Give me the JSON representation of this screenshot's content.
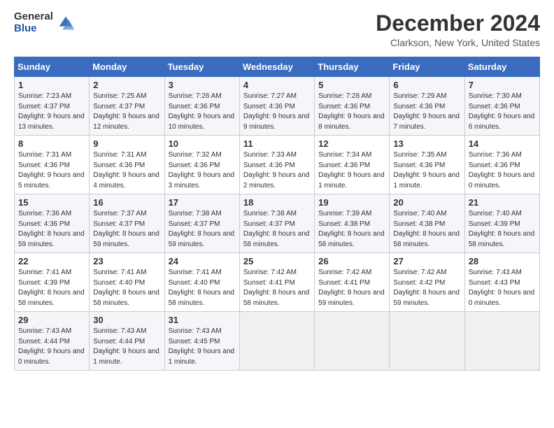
{
  "logo": {
    "general": "General",
    "blue": "Blue"
  },
  "title": "December 2024",
  "location": "Clarkson, New York, United States",
  "headers": [
    "Sunday",
    "Monday",
    "Tuesday",
    "Wednesday",
    "Thursday",
    "Friday",
    "Saturday"
  ],
  "weeks": [
    [
      {
        "day": "1",
        "sunrise": "7:23 AM",
        "sunset": "4:37 PM",
        "daylight": "9 hours and 13 minutes."
      },
      {
        "day": "2",
        "sunrise": "7:25 AM",
        "sunset": "4:37 PM",
        "daylight": "9 hours and 12 minutes."
      },
      {
        "day": "3",
        "sunrise": "7:26 AM",
        "sunset": "4:36 PM",
        "daylight": "9 hours and 10 minutes."
      },
      {
        "day": "4",
        "sunrise": "7:27 AM",
        "sunset": "4:36 PM",
        "daylight": "9 hours and 9 minutes."
      },
      {
        "day": "5",
        "sunrise": "7:28 AM",
        "sunset": "4:36 PM",
        "daylight": "9 hours and 8 minutes."
      },
      {
        "day": "6",
        "sunrise": "7:29 AM",
        "sunset": "4:36 PM",
        "daylight": "9 hours and 7 minutes."
      },
      {
        "day": "7",
        "sunrise": "7:30 AM",
        "sunset": "4:36 PM",
        "daylight": "9 hours and 6 minutes."
      }
    ],
    [
      {
        "day": "8",
        "sunrise": "7:31 AM",
        "sunset": "4:36 PM",
        "daylight": "9 hours and 5 minutes."
      },
      {
        "day": "9",
        "sunrise": "7:31 AM",
        "sunset": "4:36 PM",
        "daylight": "9 hours and 4 minutes."
      },
      {
        "day": "10",
        "sunrise": "7:32 AM",
        "sunset": "4:36 PM",
        "daylight": "9 hours and 3 minutes."
      },
      {
        "day": "11",
        "sunrise": "7:33 AM",
        "sunset": "4:36 PM",
        "daylight": "9 hours and 2 minutes."
      },
      {
        "day": "12",
        "sunrise": "7:34 AM",
        "sunset": "4:36 PM",
        "daylight": "9 hours and 1 minute."
      },
      {
        "day": "13",
        "sunrise": "7:35 AM",
        "sunset": "4:36 PM",
        "daylight": "9 hours and 1 minute."
      },
      {
        "day": "14",
        "sunrise": "7:36 AM",
        "sunset": "4:36 PM",
        "daylight": "9 hours and 0 minutes."
      }
    ],
    [
      {
        "day": "15",
        "sunrise": "7:36 AM",
        "sunset": "4:36 PM",
        "daylight": "8 hours and 59 minutes."
      },
      {
        "day": "16",
        "sunrise": "7:37 AM",
        "sunset": "4:37 PM",
        "daylight": "8 hours and 59 minutes."
      },
      {
        "day": "17",
        "sunrise": "7:38 AM",
        "sunset": "4:37 PM",
        "daylight": "8 hours and 59 minutes."
      },
      {
        "day": "18",
        "sunrise": "7:38 AM",
        "sunset": "4:37 PM",
        "daylight": "8 hours and 58 minutes."
      },
      {
        "day": "19",
        "sunrise": "7:39 AM",
        "sunset": "4:38 PM",
        "daylight": "8 hours and 58 minutes."
      },
      {
        "day": "20",
        "sunrise": "7:40 AM",
        "sunset": "4:38 PM",
        "daylight": "8 hours and 58 minutes."
      },
      {
        "day": "21",
        "sunrise": "7:40 AM",
        "sunset": "4:39 PM",
        "daylight": "8 hours and 58 minutes."
      }
    ],
    [
      {
        "day": "22",
        "sunrise": "7:41 AM",
        "sunset": "4:39 PM",
        "daylight": "8 hours and 58 minutes."
      },
      {
        "day": "23",
        "sunrise": "7:41 AM",
        "sunset": "4:40 PM",
        "daylight": "8 hours and 58 minutes."
      },
      {
        "day": "24",
        "sunrise": "7:41 AM",
        "sunset": "4:40 PM",
        "daylight": "8 hours and 58 minutes."
      },
      {
        "day": "25",
        "sunrise": "7:42 AM",
        "sunset": "4:41 PM",
        "daylight": "8 hours and 58 minutes."
      },
      {
        "day": "26",
        "sunrise": "7:42 AM",
        "sunset": "4:41 PM",
        "daylight": "8 hours and 59 minutes."
      },
      {
        "day": "27",
        "sunrise": "7:42 AM",
        "sunset": "4:42 PM",
        "daylight": "8 hours and 59 minutes."
      },
      {
        "day": "28",
        "sunrise": "7:43 AM",
        "sunset": "4:43 PM",
        "daylight": "9 hours and 0 minutes."
      }
    ],
    [
      {
        "day": "29",
        "sunrise": "7:43 AM",
        "sunset": "4:44 PM",
        "daylight": "9 hours and 0 minutes."
      },
      {
        "day": "30",
        "sunrise": "7:43 AM",
        "sunset": "4:44 PM",
        "daylight": "9 hours and 1 minute."
      },
      {
        "day": "31",
        "sunrise": "7:43 AM",
        "sunset": "4:45 PM",
        "daylight": "9 hours and 1 minute."
      },
      null,
      null,
      null,
      null
    ]
  ]
}
